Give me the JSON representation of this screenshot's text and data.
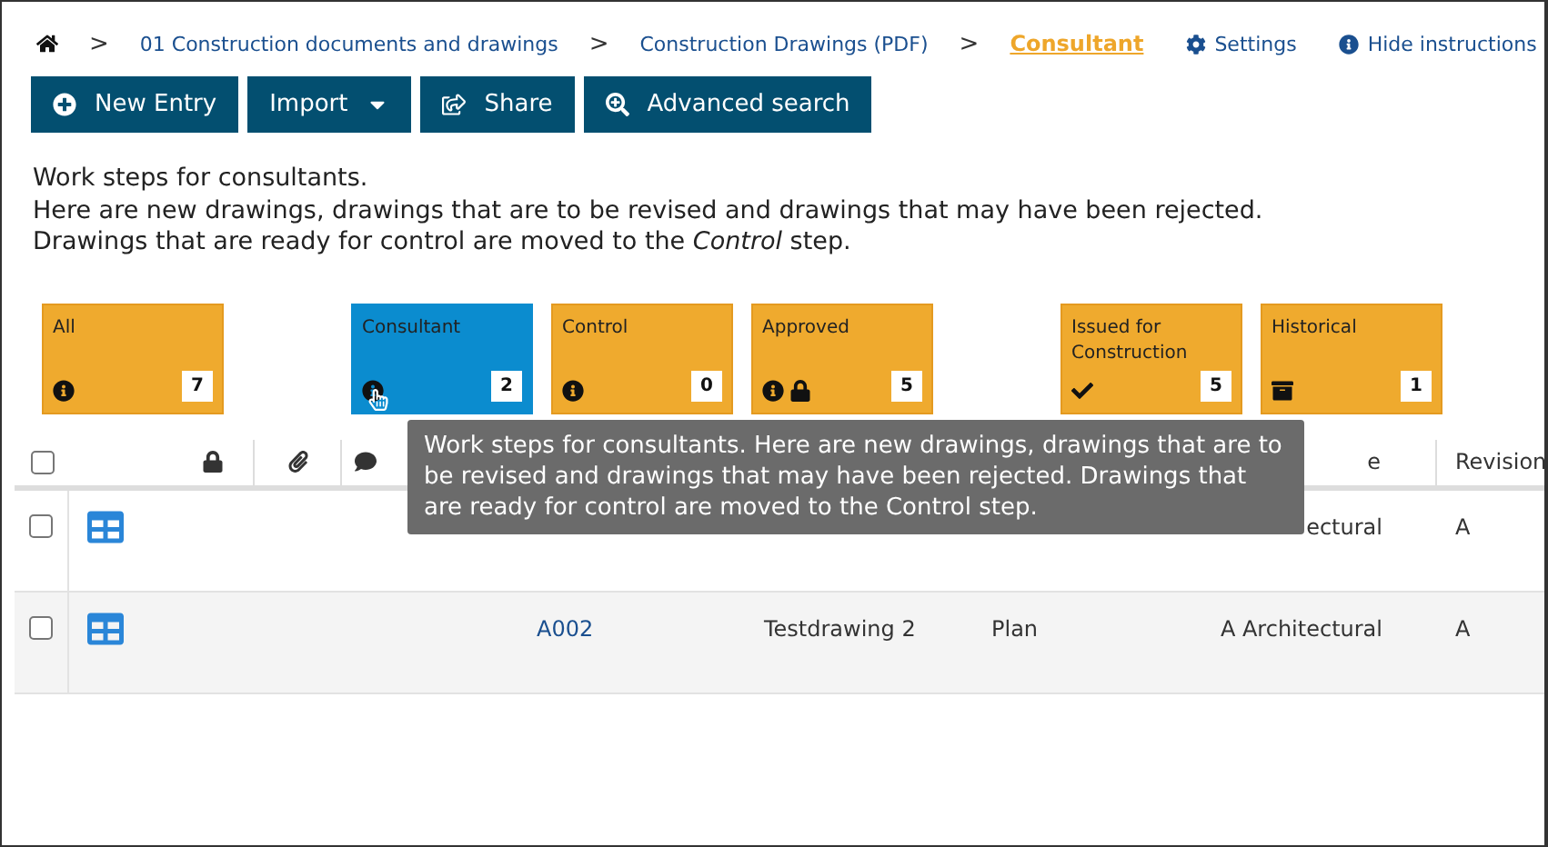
{
  "breadcrumb": {
    "separator": ">",
    "items": [
      {
        "kind": "home"
      },
      {
        "kind": "link",
        "label": "01 Construction documents and drawings",
        "selected": false
      },
      {
        "kind": "link",
        "label": "Construction Drawings (PDF)",
        "selected": false
      },
      {
        "kind": "link",
        "label": "Consultant",
        "selected": true
      }
    ]
  },
  "top_links": [
    {
      "kind": "settings",
      "label": "Settings"
    },
    {
      "kind": "info",
      "label": "Hide instructions"
    }
  ],
  "toolbar": [
    {
      "kind": "add",
      "label": "New Entry"
    },
    {
      "kind": "dropdown",
      "label": "Import"
    },
    {
      "kind": "share",
      "label": "Share"
    },
    {
      "kind": "search",
      "label": "Advanced search"
    }
  ],
  "instructions": [
    "Work steps for consultants.",
    "Here are new drawings, drawings that are to be revised and drawings that may have been rejected.",
    "Drawings that are ready for control are moved to the *Control* step."
  ],
  "step_groups": [
    [
      {
        "label": "All",
        "kind": "info",
        "count": "7",
        "selected": false
      }
    ],
    [
      {
        "label": "Consultant",
        "kind": "info",
        "count": "2",
        "selected": true
      },
      {
        "label": "Control",
        "kind": "info",
        "count": "0",
        "selected": false
      },
      {
        "label": "Approved",
        "kind": "info-locked",
        "count": "5",
        "selected": false
      }
    ],
    [
      {
        "label": "Issued for Construction",
        "kind": "check",
        "count": "5",
        "selected": false
      },
      {
        "label": "Historical",
        "kind": "archive",
        "count": "1",
        "selected": false
      }
    ]
  ],
  "table": {
    "header_checked": false,
    "columns": [
      "e",
      "Revision"
    ],
    "rows": [
      {
        "checked": false,
        "number": "",
        "title": "",
        "type": "",
        "discipline": "ectural",
        "revision": "A"
      },
      {
        "checked": false,
        "number": "A002",
        "title": "Testdrawing 2",
        "type": "Plan",
        "discipline": "A Architectural",
        "revision": "A"
      }
    ]
  },
  "tooltip": "Work steps for consultants. Here are new drawings, drawings that are to be revised and drawings that may have been rejected. Drawings that are ready for control are moved to the Control step."
}
